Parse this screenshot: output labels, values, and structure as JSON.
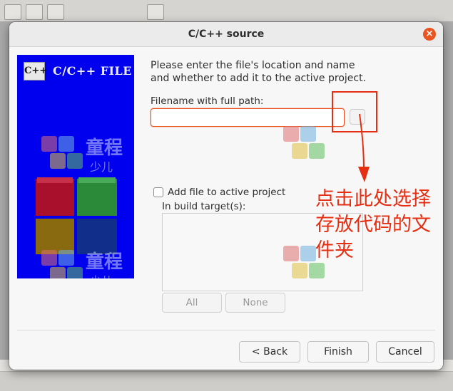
{
  "dialog": {
    "title": "C/C++ source",
    "close_glyph": "×"
  },
  "banner": {
    "logo_mark": "C++",
    "logo_text": "C/C++ FILE"
  },
  "form": {
    "intro_text": "Please enter the file's location and name and whether to add it to the active project.",
    "filename_label": "Filename with full path:",
    "filename_value": "",
    "browse_icon": "folder-browse-icon",
    "add_to_project_label": "Add file to active project",
    "add_to_project_checked": false,
    "build_targets_label": "In build target(s):",
    "build_targets": [],
    "all_label": "All",
    "none_label": "None"
  },
  "buttons": {
    "back_label": "< Back",
    "finish_label": "Finish",
    "cancel_label": "Cancel"
  },
  "annotation": {
    "text": "点击此处选择存放代码的文件夹",
    "color": "#e62e12"
  },
  "watermark": {
    "text1": "童程",
    "text2": "少儿"
  },
  "colors": {
    "accent": "#e95420",
    "banner_bg": "#0000ee"
  }
}
